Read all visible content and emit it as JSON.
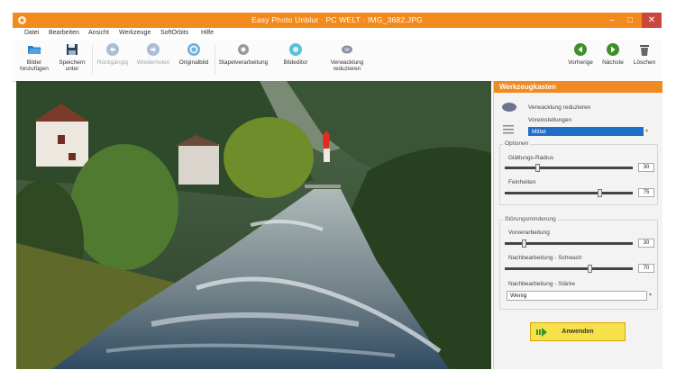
{
  "window": {
    "title": "Easy Photo Unblur · PC WELT · IMG_3682.JPG",
    "minimize": "–",
    "maximize": "□",
    "close": "✕"
  },
  "menu": [
    "Datei",
    "Bearbeiten",
    "Ansicht",
    "Werkzeuge",
    "SoftOrbits",
    "Hilfe"
  ],
  "toolbar": {
    "add": "Bilder hinzufügen",
    "save": "Speichern unter",
    "undo": "Rückgängig",
    "redo": "Wiederholen",
    "original": "Originalbild",
    "batch": "Stapelverarbeitung",
    "editor": "Bildeditor",
    "reduce": "Verwacklung reduzieren",
    "prev": "Vorherige",
    "next": "Nächste",
    "delete": "Löschen"
  },
  "panel": {
    "header": "Werkzeugkasten",
    "tool_name": "Verwacklung reduzieren",
    "presets_label": "Voreinstellungen",
    "presets_value": "Mittel",
    "options_title": "Optionen",
    "smooth_label": "Glättungs-Radius",
    "smooth_value": "30",
    "detail_label": "Feinheiten",
    "detail_value": "75",
    "noise_title": "Störungsminderung",
    "pre_label": "Vorverarbeitung",
    "pre_value": "30",
    "post_label": "Nachbearbeitung - Schwach",
    "post_value": "70",
    "strength_label": "Nachbearbeitung - Stärke",
    "strength_value": "Wenig",
    "apply": "Anwenden"
  },
  "sliders": {
    "smooth": 0.25,
    "detail": 0.75,
    "pre": 0.14,
    "post": 0.67
  },
  "colors": {
    "accent": "#f28a1c",
    "apply": "#f6e14a",
    "selection": "#1f6fc9"
  }
}
